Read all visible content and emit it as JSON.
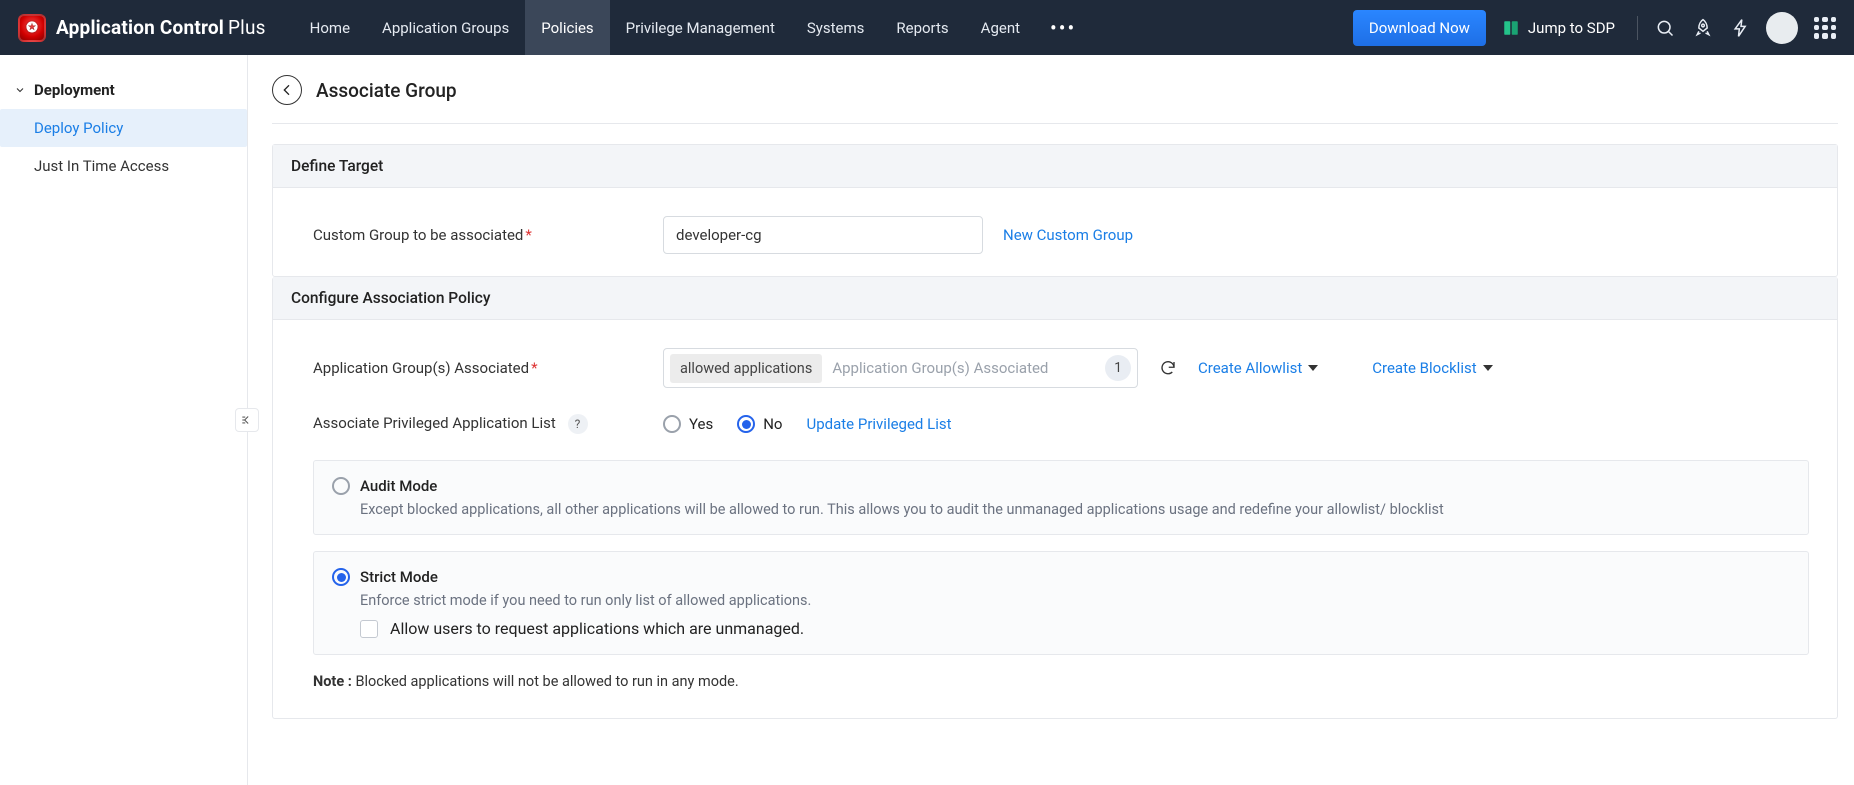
{
  "brand": {
    "name": "Application Control",
    "suffix": "Plus"
  },
  "nav": {
    "items": [
      "Home",
      "Application Groups",
      "Policies",
      "Privilege Management",
      "Systems",
      "Reports",
      "Agent"
    ],
    "active_index": 2,
    "download": "Download Now",
    "jump": "Jump to SDP"
  },
  "sidebar": {
    "heading": "Deployment",
    "items": [
      {
        "label": "Deploy Policy",
        "active": true
      },
      {
        "label": "Just In Time Access",
        "active": false
      }
    ]
  },
  "page": {
    "title": "Associate Group"
  },
  "sections": {
    "define_target": {
      "heading": "Define Target",
      "custom_group_label": "Custom Group to be associated",
      "custom_group_value": "developer-cg",
      "new_group_link": "New Custom Group"
    },
    "configure": {
      "heading": "Configure Association Policy",
      "app_groups_label": "Application Group(s) Associated",
      "chip": "allowed applications",
      "chip_placeholder": "Application Group(s) Associated",
      "chip_count": "1",
      "create_allowlist": "Create Allowlist",
      "create_blocklist": "Create Blocklist",
      "assoc_priv_label": "Associate Privileged Application List",
      "yes": "Yes",
      "no": "No",
      "priv_selected": "no",
      "update_priv_link": "Update Privileged List",
      "modes": {
        "audit": {
          "title": "Audit Mode",
          "desc": "Except blocked applications, all other applications will be allowed to run. This allows you to audit the unmanaged applications usage and redefine your allowlist/ blocklist"
        },
        "strict": {
          "title": "Strict Mode",
          "desc": "Enforce strict mode if you need to run only list of allowed applications.",
          "allow_request": "Allow users to request applications which are unmanaged."
        },
        "selected": "strict"
      },
      "note_label": "Note :",
      "note_text": " Blocked applications will not be allowed to run in any mode."
    }
  }
}
